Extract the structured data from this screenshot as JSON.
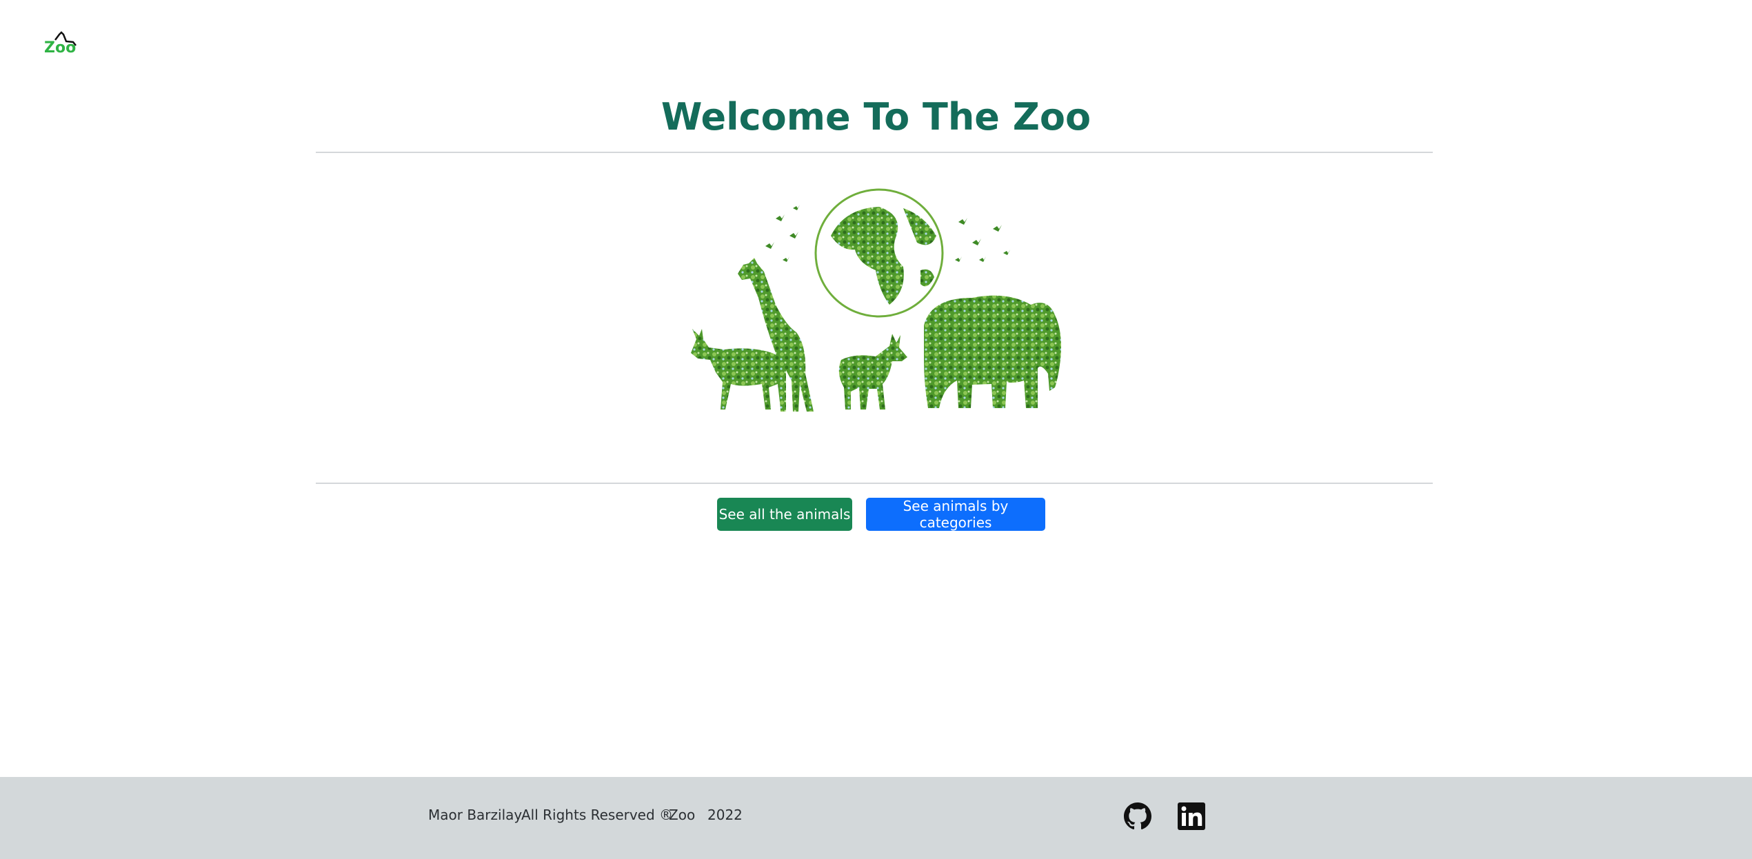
{
  "header": {
    "logo_text": "Zoo"
  },
  "main": {
    "title": "Welcome To The Zoo",
    "buttons": {
      "all_animals": "See all the animals",
      "by_categories": "See animals by categories"
    }
  },
  "footer": {
    "author": "Maor Barzilay",
    "rights": "All Rights Reserved ®",
    "site": "Zoo",
    "year": "2022",
    "icons": [
      "github-icon",
      "linkedin-icon"
    ]
  },
  "colors": {
    "title": "#146c5a",
    "green_button": "#198754",
    "blue_button": "#0d6efd",
    "footer_bg": "#d3d8da"
  }
}
